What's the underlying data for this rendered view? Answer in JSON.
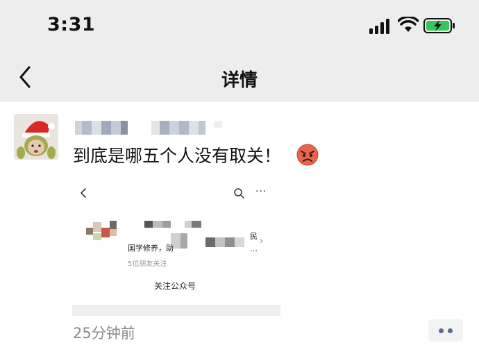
{
  "status_bar": {
    "time": "3:31",
    "signal_icon": "cellular-signal-icon",
    "wifi_icon": "wifi-icon",
    "battery_icon": "battery-charging-icon",
    "battery_color": "#34c759"
  },
  "nav": {
    "back_icon": "chevron-left-icon",
    "title": "详情"
  },
  "post": {
    "avatar_icon": "avatar-icon",
    "text": "到底是哪五个人没有取关！",
    "emoji_icon": "angry-face-emoji",
    "timestamp": "25分钟前",
    "more_icon": "more-dots-icon",
    "accent_color": "#586b95"
  },
  "screenshot": {
    "back_icon": "chevron-left-icon",
    "search_icon": "search-icon",
    "more_glyph": "···",
    "desc_text": "国学修养，助",
    "desc_suffix": "民",
    "desc_dots": "…",
    "chevron": "›",
    "friends_text": "5位朋友关注",
    "follow_label": "关注公众号"
  }
}
